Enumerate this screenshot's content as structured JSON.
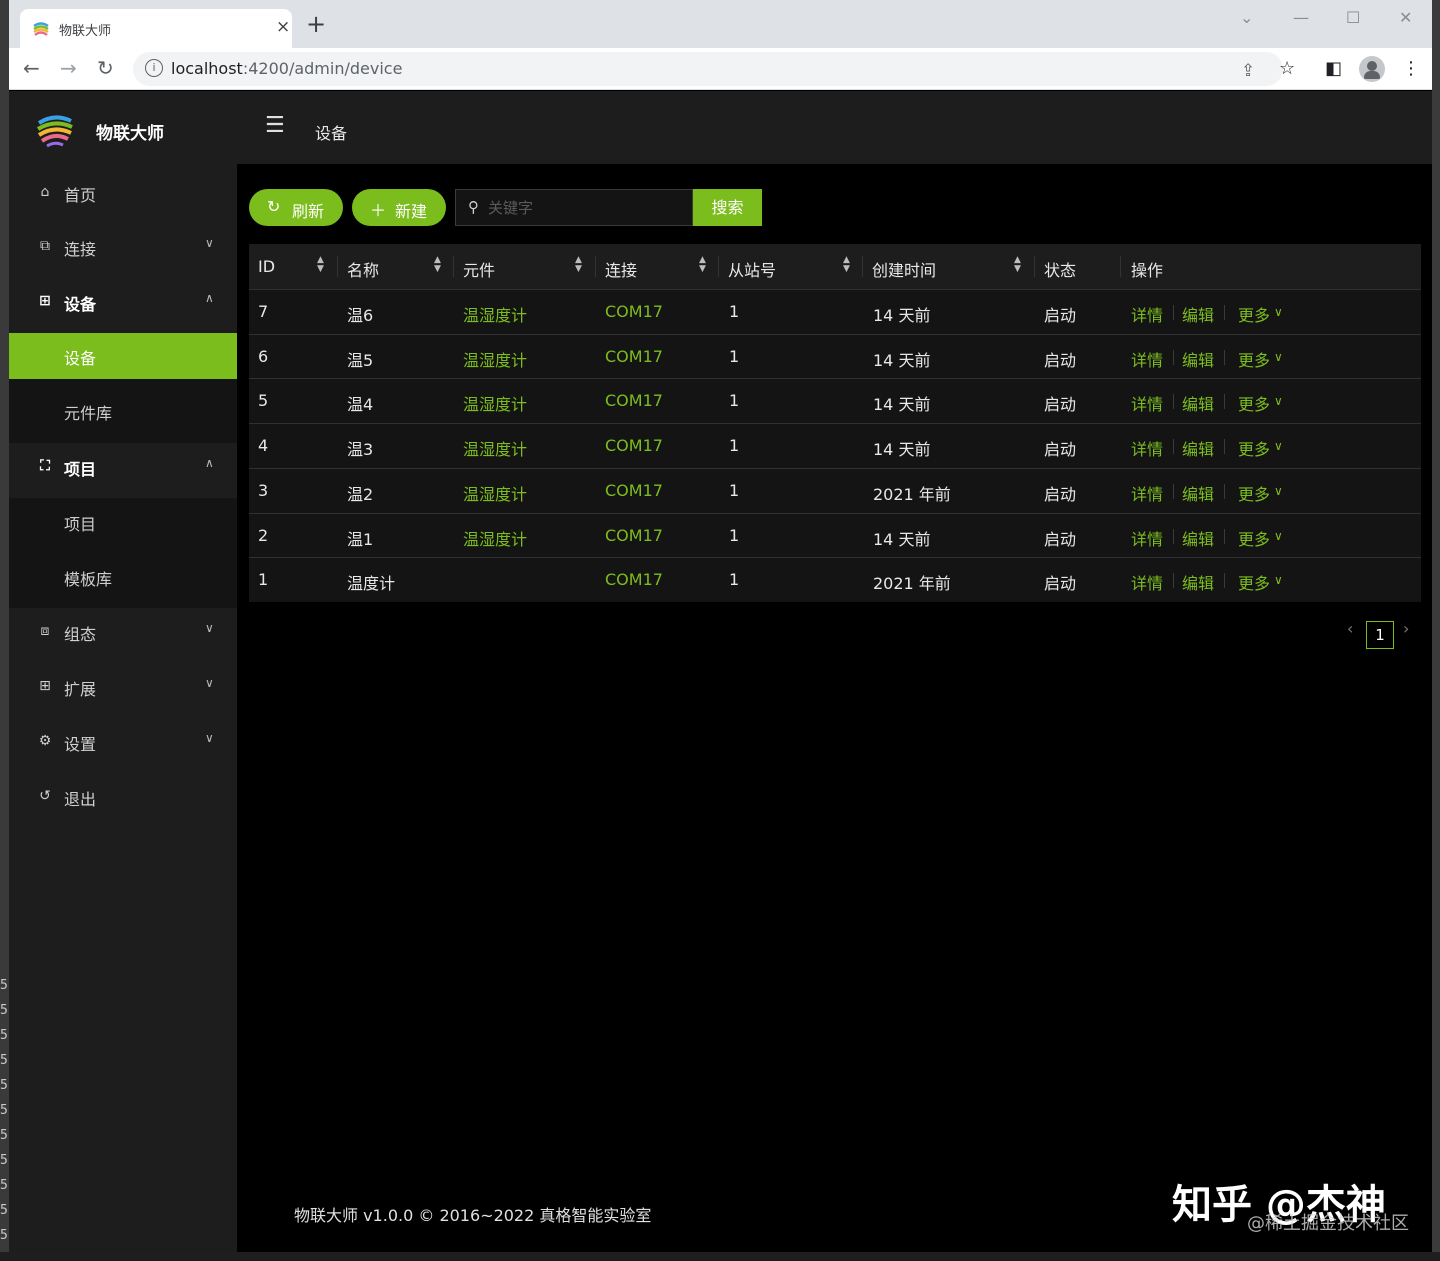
{
  "browser": {
    "tab_title": "物联大师",
    "url_host": "localhost",
    "url_path": ":4200/admin/device"
  },
  "app": {
    "logo_text": "物联大师",
    "header_title": "设备",
    "accent_color": "#7cbd1e"
  },
  "menu": {
    "home": "首页",
    "connection": "连接",
    "device": "设备",
    "device_sub": [
      "设备",
      "元件库"
    ],
    "project": "项目",
    "project_sub": [
      "项目",
      "模板库"
    ],
    "config": "组态",
    "extension": "扩展",
    "settings": "设置",
    "logout": "退出"
  },
  "toolbar": {
    "refresh_label": "刷新",
    "new_label": "新建",
    "search_placeholder": "关键字",
    "search_label": "搜索"
  },
  "table": {
    "columns": [
      "ID",
      "名称",
      "元件",
      "连接",
      "从站号",
      "创建时间",
      "状态",
      "操作"
    ],
    "rows": [
      {
        "id": "7",
        "name": "温6",
        "element": "温湿度计",
        "conn": "COM17",
        "slave": "1",
        "created": "14 天前",
        "status": "启动"
      },
      {
        "id": "6",
        "name": "温5",
        "element": "温湿度计",
        "conn": "COM17",
        "slave": "1",
        "created": "14 天前",
        "status": "启动"
      },
      {
        "id": "5",
        "name": "温4",
        "element": "温湿度计",
        "conn": "COM17",
        "slave": "1",
        "created": "14 天前",
        "status": "启动"
      },
      {
        "id": "4",
        "name": "温3",
        "element": "温湿度计",
        "conn": "COM17",
        "slave": "1",
        "created": "14 天前",
        "status": "启动"
      },
      {
        "id": "3",
        "name": "温2",
        "element": "温湿度计",
        "conn": "COM17",
        "slave": "1",
        "created": "2021 年前",
        "status": "启动"
      },
      {
        "id": "2",
        "name": "温1",
        "element": "温湿度计",
        "conn": "COM17",
        "slave": "1",
        "created": "14 天前",
        "status": "启动"
      },
      {
        "id": "1",
        "name": "温度计",
        "element": "",
        "conn": "COM17",
        "slave": "1",
        "created": "2021 年前",
        "status": "启动"
      }
    ],
    "actions": {
      "detail": "详情",
      "edit": "编辑",
      "more": "更多"
    }
  },
  "pagination": {
    "current": "1"
  },
  "footer": {
    "text": "物联大师 v1.0.0 © 2016~2022 真格智能实验室"
  },
  "watermark": {
    "main": "知乎 @杰神",
    "sub": "@稀土掘金技术社区"
  },
  "side_gutter_numbers": [
    "5",
    "5",
    "5",
    "5",
    "5",
    "5",
    "5",
    "5",
    "5",
    "5",
    "5"
  ]
}
